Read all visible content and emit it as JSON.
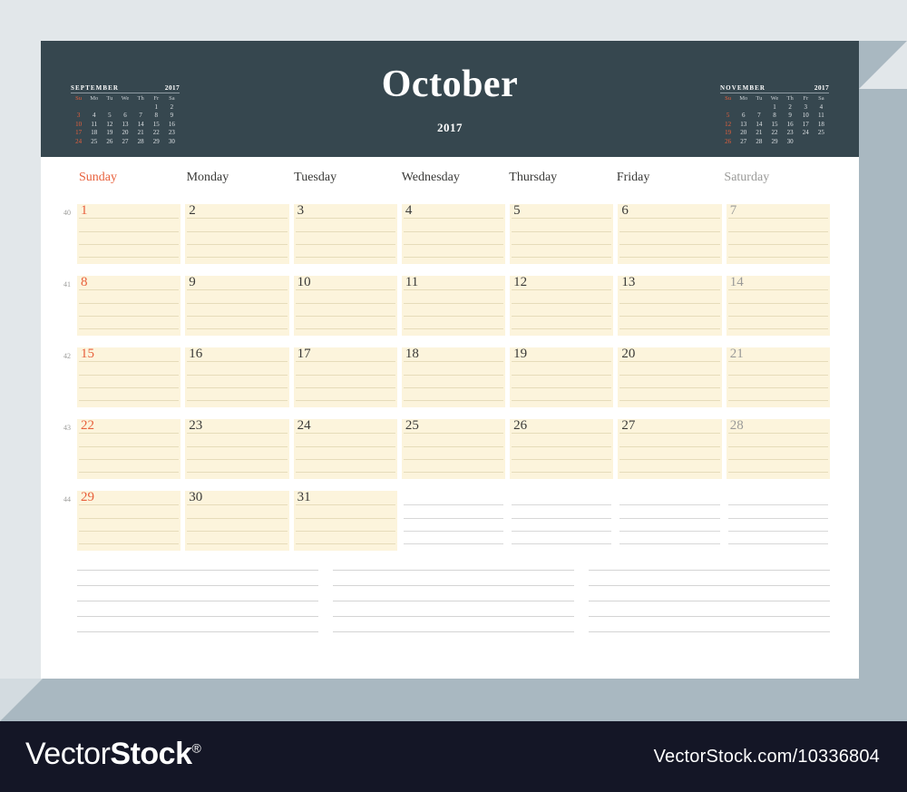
{
  "colors": {
    "header_bg": "#36474f",
    "sheet_bg": "#ffffff",
    "page_bg": "#e2e7ea",
    "shadow": "#a9b8c1",
    "accent_red": "#e8603c",
    "muted_gray": "#9a9a98",
    "cell_cream": "#fcf4dc",
    "cell_line": "#e6dcba",
    "blank_line": "#d8d8d8",
    "footer_bg": "#141626"
  },
  "header": {
    "month": "October",
    "year": "2017"
  },
  "mini_prev": {
    "name": "SEPTEMBER",
    "year": "2017",
    "dow": [
      "Su",
      "Mo",
      "Tu",
      "We",
      "Th",
      "Fr",
      "Sa"
    ],
    "weeks": [
      [
        "",
        "",
        "",
        "",
        "",
        "1",
        "2"
      ],
      [
        "3",
        "4",
        "5",
        "6",
        "7",
        "8",
        "9"
      ],
      [
        "10",
        "11",
        "12",
        "13",
        "14",
        "15",
        "16"
      ],
      [
        "17",
        "18",
        "19",
        "20",
        "21",
        "22",
        "23"
      ],
      [
        "24",
        "25",
        "26",
        "27",
        "28",
        "29",
        "30"
      ]
    ]
  },
  "mini_next": {
    "name": "NOVEMBER",
    "year": "2017",
    "dow": [
      "Su",
      "Mo",
      "Tu",
      "We",
      "Th",
      "Fr",
      "Sa"
    ],
    "weeks": [
      [
        "",
        "",
        "",
        "1",
        "2",
        "3",
        "4"
      ],
      [
        "5",
        "6",
        "7",
        "8",
        "9",
        "10",
        "11"
      ],
      [
        "12",
        "13",
        "14",
        "15",
        "16",
        "17",
        "18"
      ],
      [
        "19",
        "20",
        "21",
        "22",
        "23",
        "24",
        "25"
      ],
      [
        "26",
        "27",
        "28",
        "29",
        "30",
        "",
        ""
      ]
    ]
  },
  "weekdays": [
    "Sunday",
    "Monday",
    "Tuesday",
    "Wednesday",
    "Thursday",
    "Friday",
    "Saturday"
  ],
  "week_numbers": [
    "40",
    "41",
    "42",
    "43",
    "44"
  ],
  "weeks": [
    [
      "1",
      "2",
      "3",
      "4",
      "5",
      "6",
      "7"
    ],
    [
      "8",
      "9",
      "10",
      "11",
      "12",
      "13",
      "14"
    ],
    [
      "15",
      "16",
      "17",
      "18",
      "19",
      "20",
      "21"
    ],
    [
      "22",
      "23",
      "24",
      "25",
      "26",
      "27",
      "28"
    ],
    [
      "29",
      "30",
      "31",
      "",
      "",
      "",
      ""
    ]
  ],
  "notes": {
    "blocks": 3,
    "lines_per_block": 5
  },
  "footer": {
    "logo_light": "Vector",
    "logo_bold": "Stock",
    "logo_reg": "®",
    "url": "VectorStock.com/10336804"
  }
}
